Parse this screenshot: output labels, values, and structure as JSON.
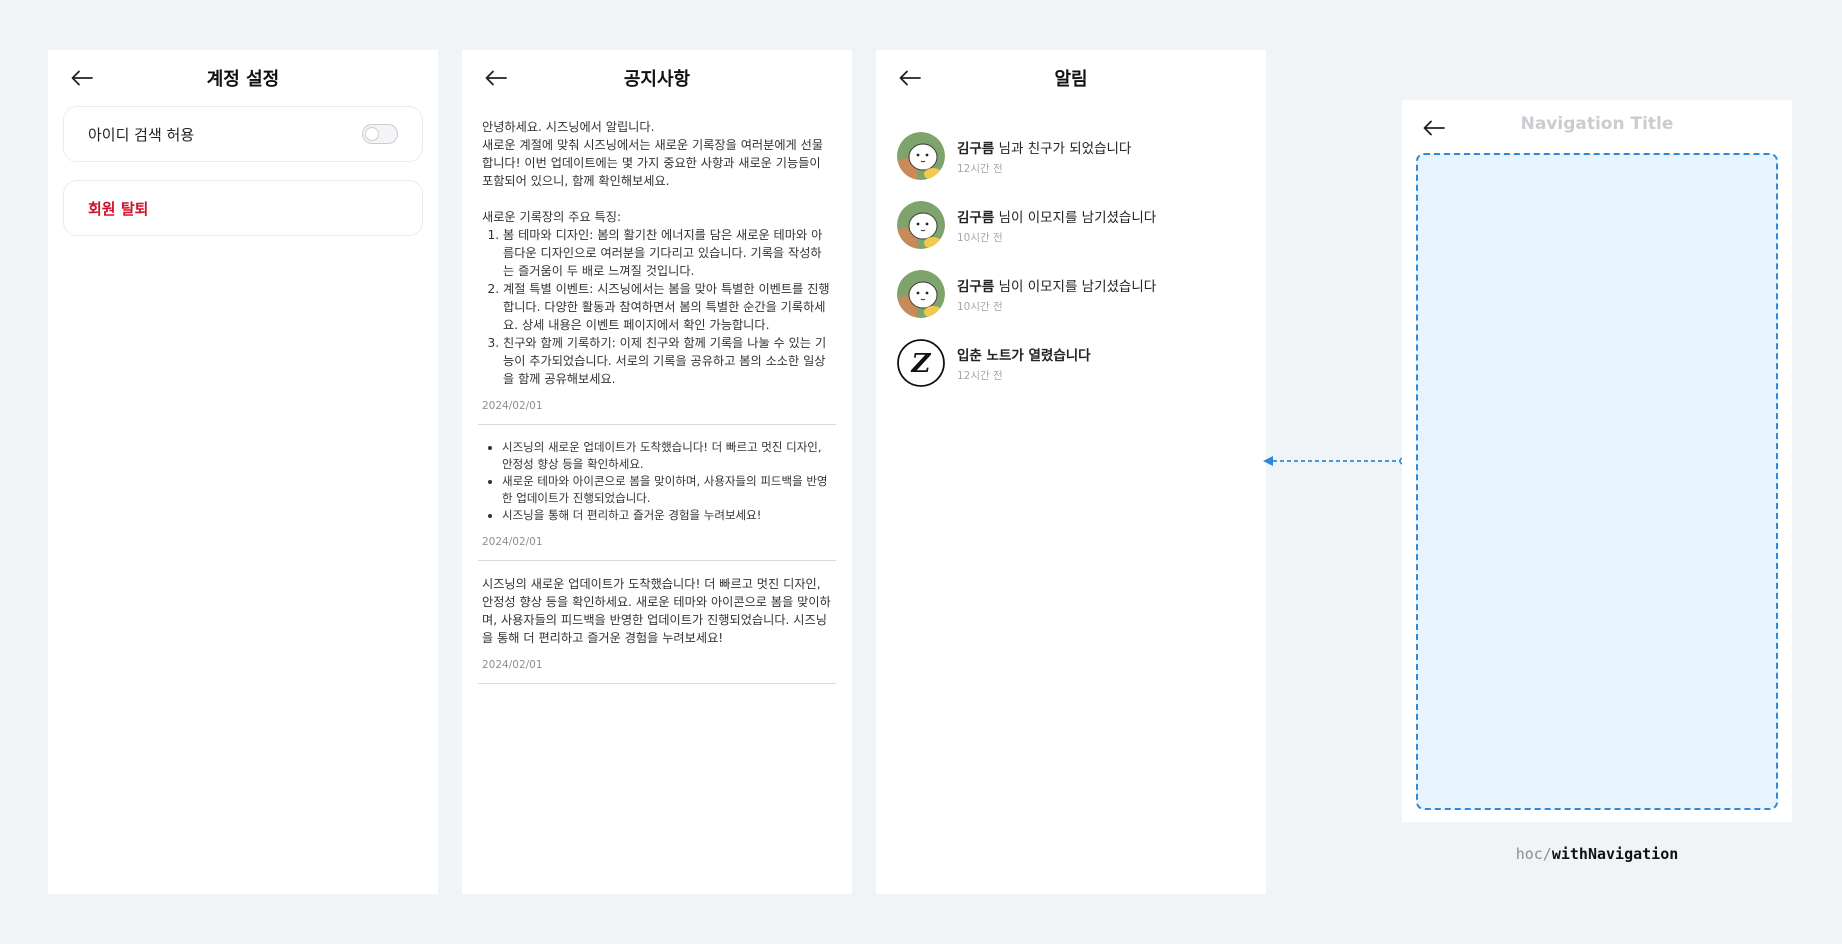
{
  "account_settings": {
    "title": "계정 설정",
    "id_search_label": "아이디 검색 허용",
    "id_search_enabled": false,
    "withdraw_label": "회원 탈퇴"
  },
  "notices": {
    "title": "공지사항",
    "items": [
      {
        "intro": "안녕하세요. 시즈닝에서 알립니다.",
        "paragraph": "새로운 계절에 맞춰 시즈닝에서는 새로운 기록장을 여러분에게 선물합니다! 이번 업데이트에는 몇 가지 중요한 사항과 새로운 기능들이 포함되어 있으니, 함께 확인해보세요.",
        "features_heading": "새로운 기록장의 주요 특징:",
        "features": [
          "봄 테마와 디자인: 봄의 활기찬 에너지를 담은 새로운 테마와 아름다운 디자인으로 여러분을 기다리고 있습니다. 기록을 작성하는 즐거움이 두 배로 느껴질 것입니다.",
          "계절 특별 이벤트: 시즈닝에서는 봄을 맞아 특별한 이벤트를 진행합니다. 다양한 활동과 참여하면서 봄의 특별한 순간을 기록하세요. 상세 내용은 이벤트 페이지에서 확인 가능합니다.",
          "친구와 함께 기록하기: 이제 친구와 함께 기록을 나눌 수 있는 기능이 추가되었습니다. 서로의 기록을 공유하고 봄의 소소한 일상을 함께 공유해보세요."
        ],
        "date": "2024/02/01"
      },
      {
        "bullets": [
          "시즈닝의 새로운 업데이트가 도착했습니다! 더 빠르고 멋진 디자인, 안정성 향상 등을 확인하세요.",
          "새로운 테마와 아이콘으로 봄을 맞이하며, 사용자들의 피드백을 반영한 업데이트가 진행되었습니다.",
          "시즈닝을 통해 더 편리하고 즐거운 경험을 누려보세요!"
        ],
        "date": "2024/02/01"
      },
      {
        "paragraph": "시즈닝의 새로운 업데이트가 도착했습니다! 더 빠르고 멋진 디자인, 안정성 향상 등을 확인하세요. 새로운 테마와 아이콘으로 봄을 맞이하며, 사용자들의 피드백을 반영한 업데이트가 진행되었습니다. 시즈닝을 통해 더 편리하고 즐거운 경험을 누려보세요!",
        "date": "2024/02/01"
      }
    ]
  },
  "alarms": {
    "title": "알림",
    "items": [
      {
        "name": "김구름",
        "message": " 님과 친구가 되었습니다",
        "time": "12시간 전",
        "avatar": "character-avatar"
      },
      {
        "name": "김구름",
        "message": " 님이 이모지를 남기셨습니다",
        "time": "10시간 전",
        "avatar": "character-avatar"
      },
      {
        "name": "김구름",
        "message": " 님이 이모지를 남기셨습니다",
        "time": "10시간 전",
        "avatar": "character-avatar"
      },
      {
        "name": "",
        "message": "입춘 노트가 열렸습니다",
        "time": "12시간 전",
        "avatar": "season-logo",
        "logo_letter": "Z"
      }
    ]
  },
  "hoc": {
    "nav_title": "Navigation Title",
    "caption_prefix": "hoc/",
    "caption_name": "withNavigation",
    "accent_color": "#2e8ad8",
    "slot_fill": "#e8f4fd"
  }
}
